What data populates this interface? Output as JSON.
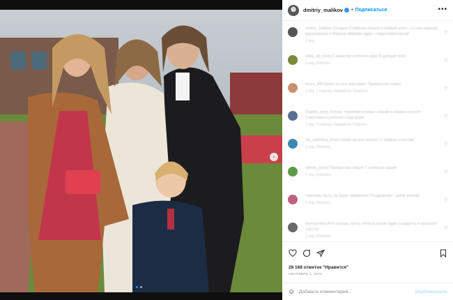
{
  "header": {
    "username": "dmitriy_malikov",
    "follow_label": "Подписаться",
    "more_label": "•••"
  },
  "photo": {
    "description_icon": "photo-family-icon",
    "next_label": "›"
  },
  "comments": [
    {
      "avatar_color": "#555555",
      "text": "dmitriy_malikov Сегодня Стефания пошла в первый класс, а к нам пришла вдохновение и Марина впереди вдруг с подготовительной",
      "meta": "2 нед."
    },
    {
      "avatar_color": "#7a8a3a",
      "text": "milky_de_nova С началом учебного года! В добрый путь!",
      "meta": "1 нед.   Ответить"
    },
    {
      "avatar_color": "#c89070",
      "text": "tanya_999 Какие вы все красивые! Прекрасная семья",
      "meta": "2 нед.   1 отметка «Нравится»   Ответить"
    },
    {
      "avatar_color": "#5a7090",
      "text": "English_party Успеха, терпения и новых знаний в первом классе! Счастливого учебного года всем!",
      "meta": "1 нед.   4 отметки «Нравится»   Ответить"
    },
    {
      "avatar_color": "#3c8ab0",
      "text": "ola_valentina_lenina Какие вы все милые! С первым классом!",
      "meta": "1 нед.   Ответить"
    },
    {
      "avatar_color": "#5c9a4a",
      "text": "milena_tofree Прекрасная семья! С учебным годом!",
      "meta": "1 нед.   Ответить"
    },
    {
      "avatar_color": "#c06080",
      "text": "natavoda Пусть он будет примером! Поздравляю с днём знаний!",
      "meta": "1 нед.   Ответить"
    },
    {
      "avatar_color": "#6a6a6a",
      "text": "mariasmaria Всё хорошо, пусть учёба в школе будет в радость и приносит счастье",
      "meta": "1 нед.   Ответить"
    }
  ],
  "actions": {
    "like_icon": "heart-icon",
    "comment_icon": "comment-icon",
    "share_icon": "send-icon",
    "save_icon": "bookmark-icon",
    "likes_text": "28 168 отметок \"Нравится\"",
    "date_text": "СЕНТЯБРЬ 1, 2022"
  },
  "add_comment": {
    "placeholder": "Добавьте комментарий...",
    "publish_label": "Опубликовать",
    "emoji_icon": "emoji-icon"
  },
  "colors": {
    "accent": "#0095f6",
    "text": "#262626",
    "muted": "#8e8e8e"
  }
}
